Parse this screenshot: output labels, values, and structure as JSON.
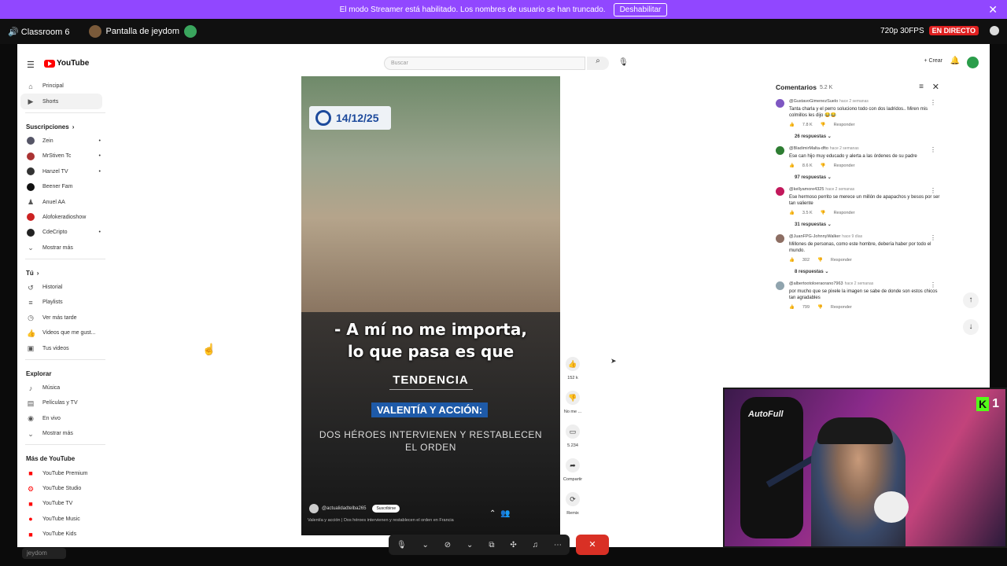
{
  "banner": {
    "message": "El modo Streamer está habilitado. Los nombres de usuario se han truncado.",
    "button_label": "Deshabilitar",
    "close_icon": "close-icon"
  },
  "call": {
    "channel": "🔊 Classroom 6",
    "screen_share": "Pantalla de jeydom",
    "quality": "720p 30FPS",
    "live_label": "EN DIRECTO"
  },
  "youtube": {
    "logo_text": "YouTube",
    "search_placeholder": "Buscar",
    "create_label": "+ Crear",
    "sidebar": {
      "top": [
        {
          "label": "Principal",
          "icon": "home-icon"
        },
        {
          "label": "Shorts",
          "icon": "shorts-icon"
        }
      ],
      "subscriptions_header": "Suscripciones",
      "subscriptions": [
        {
          "label": "Zein",
          "dot": "•"
        },
        {
          "label": "MrStiven Tc",
          "dot": "•"
        },
        {
          "label": "Hanzel TV",
          "dot": "•"
        },
        {
          "label": "Beener Fam",
          "dot": ""
        },
        {
          "label": "Anuel AA",
          "dot": ""
        },
        {
          "label": "Alofokeradioshow",
          "dot": ""
        },
        {
          "label": "CdeCripto",
          "dot": "•"
        },
        {
          "label": "Mostrar más",
          "dot": ""
        }
      ],
      "you_header": "Tú",
      "you": [
        {
          "label": "Historial"
        },
        {
          "label": "Playlists"
        },
        {
          "label": "Ver más tarde"
        },
        {
          "label": "Videos que me gust..."
        },
        {
          "label": "Tus videos"
        }
      ],
      "explore_header": "Explorar",
      "explore": [
        {
          "label": "Música"
        },
        {
          "label": "Películas y TV"
        },
        {
          "label": "En vivo"
        },
        {
          "label": "Mostrar más"
        }
      ],
      "more_header": "Más de YouTube",
      "more": [
        {
          "label": "YouTube Premium"
        },
        {
          "label": "YouTube Studio"
        },
        {
          "label": "YouTube TV"
        },
        {
          "label": "YouTube Music"
        },
        {
          "label": "YouTube Kids"
        }
      ]
    },
    "video": {
      "date_badge": "14/12/25",
      "quote_line1": "- A mí no me importa,",
      "quote_line2": "lo que pasa es que",
      "trend": "TENDENCIA",
      "highlight": "VALENTÍA Y ACCIÓN:",
      "headline": "DOS HÉROES INTERVIENEN Y RESTABLECEN EL ORDEN",
      "channel": "@actualidadtelba265",
      "subscribe": "Suscribirse",
      "description": "Valentía y acción | Dos héroes intervienen y restablecen el orden en Francia"
    },
    "actions": [
      {
        "icon": "like-icon",
        "label": "152 k"
      },
      {
        "icon": "dislike-icon",
        "label": "No me ..."
      },
      {
        "icon": "comment-icon",
        "label": "5.234"
      },
      {
        "icon": "share-icon",
        "label": "Compartir"
      },
      {
        "icon": "remix-icon",
        "label": "Remix"
      }
    ],
    "comments": {
      "title": "Comentarios",
      "count": "5.2 K",
      "items": [
        {
          "user": "@GustavoGimenezSuelo",
          "when": "hace 2 semanas",
          "text": "Tanta charla y el perro soluciono todo con dos ladridos.. Miren mis colmillos les dijo 😂😂",
          "likes": "7.8 K",
          "reply": "Responder",
          "replies": "26 respuestas",
          "color": "#7e57c2"
        },
        {
          "user": "@BladimirMalta-dfto",
          "when": "hace 2 semanas",
          "text": "Ese can hijo muy educado y alerta a las órdenes de su padre",
          "likes": "8.6 K",
          "reply": "Responder",
          "replies": "97 respuestas",
          "color": "#2e7d32"
        },
        {
          "user": "@kellyamore4325",
          "when": "hace 2 semanas",
          "text": "Ese hermoso perrito se merece un millón de apapachos y besos por ser tan valiente",
          "likes": "3.5 K",
          "reply": "Responder",
          "replies": "31 respuestas",
          "color": "#c2185b"
        },
        {
          "user": "@JuanFPG-JohnnyWalker",
          "when": "hace 9 días",
          "text": "Millones de personas, como este hombre, debería haber por todo el mundo.",
          "likes": "302",
          "reply": "Responder",
          "replies": "8 respuestas",
          "color": "#8d6e63"
        },
        {
          "user": "@albertootoloeraorano7963",
          "when": "hace 2 semanas",
          "text": "por mucho que se pixele la imagen se sabe de donde son estos chicos tan agradables",
          "likes": "799",
          "reply": "Responder",
          "replies": "",
          "color": "#90a4ae"
        }
      ]
    }
  },
  "webcam": {
    "chair_brand": "AutoFull",
    "platform_count": "1"
  },
  "status_tag": "jeydom"
}
